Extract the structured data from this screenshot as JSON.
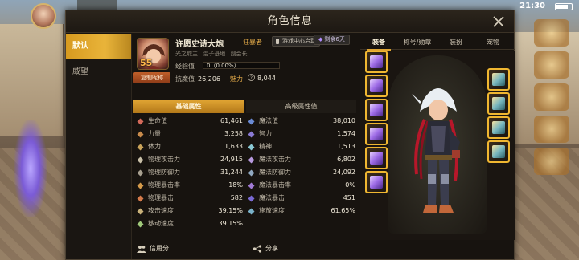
{
  "status_bar": {
    "time": "21:30"
  },
  "window": {
    "title": "角色信息"
  },
  "side_tabs": [
    {
      "label": "默认"
    },
    {
      "label": "威望"
    }
  ],
  "profile": {
    "level": "55",
    "name": "许愿史诗大炮",
    "job": "狂暴者",
    "center_badge": "游戏中心启动",
    "server": "光之城主",
    "guild": "混子基地",
    "guild_role": "副会长",
    "copy_label": "复制昵称",
    "expiry": "剩余6天",
    "exp_label": "经验值",
    "exp_text": "0（0.00%）",
    "exp_fraction": 0,
    "resist_label": "抗魔值",
    "resist_value": "26,206",
    "charm_label": "魅力",
    "charm_value": "8,044"
  },
  "attr_tabs": {
    "basic": "基础属性",
    "advanced": "高级属性值"
  },
  "attrs": [
    {
      "l_icon": "heart-icon",
      "l_name": "生命值",
      "l_val": "61,461",
      "r_icon": "mana-icon",
      "r_name": "魔法值",
      "r_val": "38,010"
    },
    {
      "l_icon": "fist-icon",
      "l_name": "力量",
      "l_val": "3,258",
      "r_icon": "book-icon",
      "r_name": "智力",
      "r_val": "1,574"
    },
    {
      "l_icon": "body-icon",
      "l_name": "体力",
      "l_val": "1,633",
      "r_icon": "spirit-icon",
      "r_name": "精神",
      "r_val": "1,513"
    },
    {
      "l_icon": "sword-icon",
      "l_name": "物理攻击力",
      "l_val": "24,915",
      "r_icon": "staff-icon",
      "r_name": "魔法攻击力",
      "r_val": "6,802"
    },
    {
      "l_icon": "shield-icon",
      "l_name": "物理防御力",
      "l_val": "31,244",
      "r_icon": "magic-shield-icon",
      "r_name": "魔法防御力",
      "r_val": "24,092"
    },
    {
      "l_icon": "crit-icon",
      "l_name": "物理暴击率",
      "l_val": "18%",
      "r_icon": "magic-crit-icon",
      "r_name": "魔法暴击率",
      "r_val": "0%"
    },
    {
      "l_icon": "crit-dmg-icon",
      "l_name": "物理暴击",
      "l_val": "582",
      "r_icon": "magic-crit-dmg-icon",
      "r_name": "魔法暴击",
      "r_val": "451"
    },
    {
      "l_icon": "attack-speed-icon",
      "l_name": "攻击速度",
      "l_val": "39.15%",
      "r_icon": "cast-speed-icon",
      "r_name": "施放速度",
      "r_val": "61.65%"
    },
    {
      "l_icon": "move-speed-icon",
      "l_name": "移动速度",
      "l_val": "39.15%",
      "r_icon": "",
      "r_name": "",
      "r_val": ""
    }
  ],
  "footer": {
    "credit": "信用分",
    "share": "分享"
  },
  "equip_tabs": [
    "装备",
    "称号/勋章",
    "装扮",
    "宠物"
  ],
  "colors": {
    "accent": "#e0a634",
    "panel": "#17130f",
    "value": "#efe8d8",
    "label": "#bdb5a5"
  }
}
